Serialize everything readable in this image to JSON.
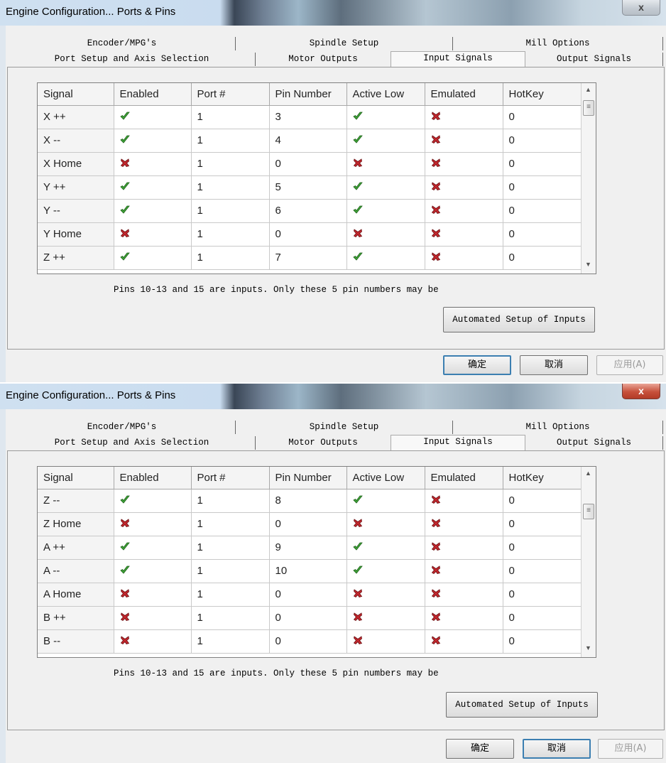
{
  "window": {
    "title": "Engine Configuration... Ports & Pins",
    "close_label": "x"
  },
  "tabs": {
    "top": [
      "Encoder/MPG's",
      "Spindle Setup",
      "Mill Options"
    ],
    "bottom": [
      "Port Setup and Axis Selection",
      "Motor Outputs",
      "Input Signals",
      "Output Signals"
    ],
    "active": "Input Signals"
  },
  "table": {
    "columns": [
      "Signal",
      "Enabled",
      "Port #",
      "Pin Number",
      "Active Low",
      "Emulated",
      "HotKey"
    ]
  },
  "icons": {
    "check": "check-icon",
    "cross": "cross-icon",
    "check_color": "#3fa637",
    "cross_color": "#c1272d"
  },
  "panels": [
    {
      "rows": [
        {
          "signal": "X ++",
          "enabled": true,
          "port": "1",
          "pin": "3",
          "active_low": true,
          "emulated": false,
          "hotkey": "0"
        },
        {
          "signal": "X --",
          "enabled": true,
          "port": "1",
          "pin": "4",
          "active_low": true,
          "emulated": false,
          "hotkey": "0"
        },
        {
          "signal": "X Home",
          "enabled": false,
          "port": "1",
          "pin": "0",
          "active_low": false,
          "emulated": false,
          "hotkey": "0"
        },
        {
          "signal": "Y ++",
          "enabled": true,
          "port": "1",
          "pin": "5",
          "active_low": true,
          "emulated": false,
          "hotkey": "0"
        },
        {
          "signal": "Y --",
          "enabled": true,
          "port": "1",
          "pin": "6",
          "active_low": true,
          "emulated": false,
          "hotkey": "0"
        },
        {
          "signal": "Y Home",
          "enabled": false,
          "port": "1",
          "pin": "0",
          "active_low": false,
          "emulated": false,
          "hotkey": "0"
        },
        {
          "signal": "Z ++",
          "enabled": true,
          "port": "1",
          "pin": "7",
          "active_low": true,
          "emulated": false,
          "hotkey": "0"
        }
      ]
    },
    {
      "rows": [
        {
          "signal": "Z --",
          "enabled": true,
          "port": "1",
          "pin": "8",
          "active_low": true,
          "emulated": false,
          "hotkey": "0"
        },
        {
          "signal": "Z Home",
          "enabled": false,
          "port": "1",
          "pin": "0",
          "active_low": false,
          "emulated": false,
          "hotkey": "0"
        },
        {
          "signal": "A ++",
          "enabled": true,
          "port": "1",
          "pin": "9",
          "active_low": true,
          "emulated": false,
          "hotkey": "0"
        },
        {
          "signal": "A --",
          "enabled": true,
          "port": "1",
          "pin": "10",
          "active_low": true,
          "emulated": false,
          "hotkey": "0"
        },
        {
          "signal": "A Home",
          "enabled": false,
          "port": "1",
          "pin": "0",
          "active_low": false,
          "emulated": false,
          "hotkey": "0"
        },
        {
          "signal": "B ++",
          "enabled": false,
          "port": "1",
          "pin": "0",
          "active_low": false,
          "emulated": false,
          "hotkey": "0"
        },
        {
          "signal": "B --",
          "enabled": false,
          "port": "1",
          "pin": "0",
          "active_low": false,
          "emulated": false,
          "hotkey": "0"
        }
      ]
    }
  ],
  "note": "Pins 10-13 and 15 are inputs. Only these 5 pin numbers may be",
  "buttons": {
    "automated_setup": "Automated Setup of Inputs",
    "ok": "确定",
    "cancel": "取消",
    "apply": "应用(A)"
  }
}
